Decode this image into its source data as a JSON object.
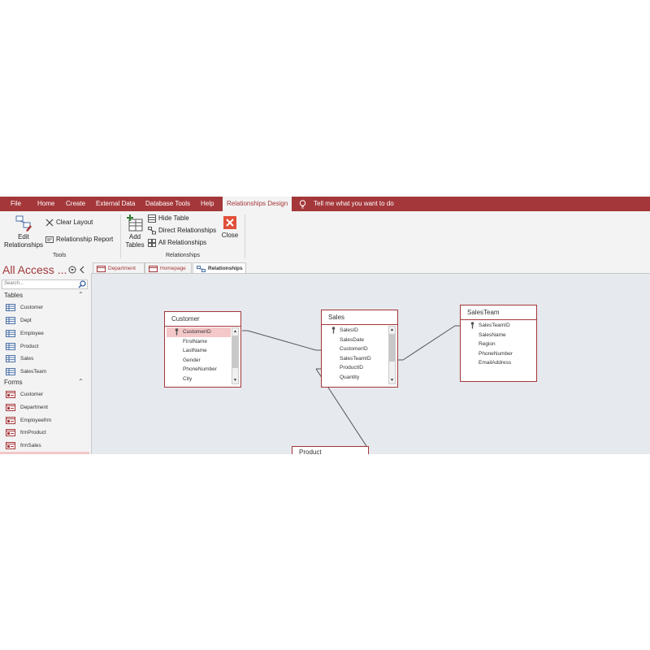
{
  "menu": {
    "items": [
      "File",
      "Home",
      "Create",
      "External Data",
      "Database Tools",
      "Help"
    ],
    "active": "Relationships Design",
    "tell_me": "Tell me what you want to do"
  },
  "ribbon": {
    "tools": {
      "edit_relationships": [
        "Edit",
        "Relationships"
      ],
      "clear_layout": "Clear Layout",
      "relationship_report": "Relationship Report",
      "label": "Tools"
    },
    "relationships": {
      "add_tables": [
        "Add",
        "Tables"
      ],
      "hide_table": "Hide Table",
      "direct_relationships": "Direct Relationships",
      "all_relationships": "All Relationships",
      "close": "Close",
      "label": "Relationships"
    }
  },
  "nav": {
    "title": "All Access ...",
    "search_placeholder": "Search...",
    "tables_header": "Tables",
    "tables": [
      "Customer",
      "Dept",
      "Employee",
      "Product",
      "Sales",
      "SalesTeam"
    ],
    "forms_header": "Forms",
    "forms": [
      "Customer",
      "Department",
      "Employeefrm",
      "frmProduct",
      "frmSales"
    ]
  },
  "doc_tabs": [
    "Department",
    "Homepage",
    "Relationships"
  ],
  "tables": {
    "customer": {
      "name": "Customer",
      "fields": [
        "CustomerID",
        "FirstName",
        "LastName",
        "Gender",
        "PhoneNumber",
        "City"
      ]
    },
    "sales": {
      "name": "Sales",
      "fields": [
        "SalesID",
        "SalesDate",
        "CustomerID",
        "SalesTeamID",
        "ProductID",
        "Quantity"
      ]
    },
    "salesteam": {
      "name": "SalesTeam",
      "fields": [
        "SalesTeamID",
        "SalesName",
        "Region",
        "PhoneNumber",
        "EmailAddress"
      ]
    },
    "product": {
      "name": "Product"
    }
  },
  "colors": {
    "accent": "#a4373a",
    "selected_row": "#f4c7c8",
    "canvas": "#e6e9ee"
  }
}
